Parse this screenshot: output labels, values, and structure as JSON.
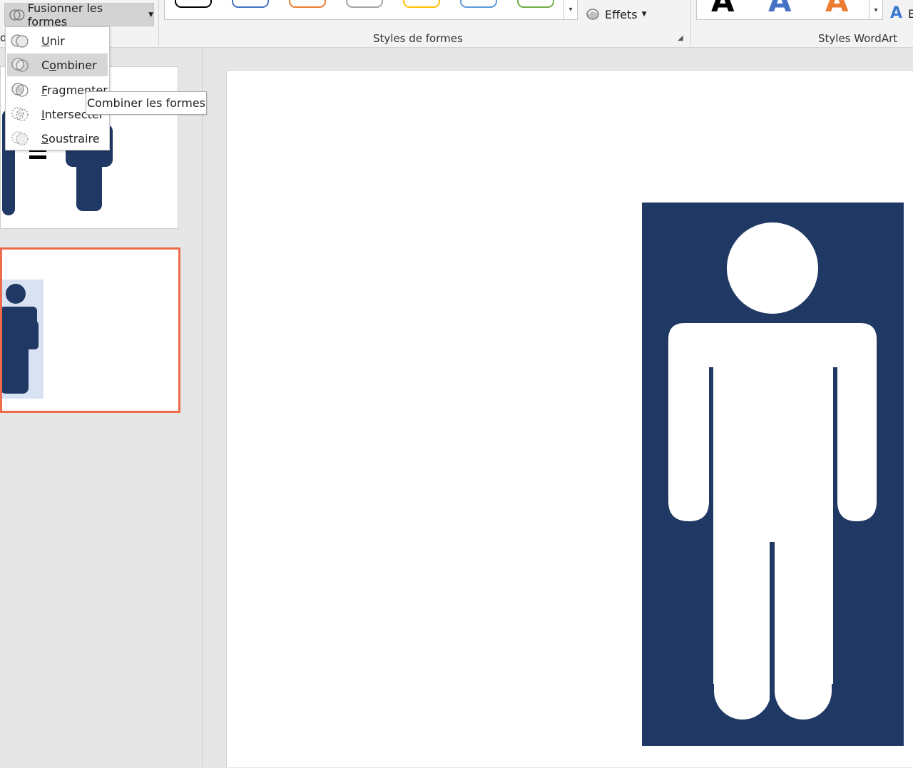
{
  "ribbon": {
    "merge_shapes_label": "Fusionner les formes",
    "edge_letter": "d",
    "effects_label": "Effets",
    "shape_styles_label": "Styles de formes",
    "wordart_styles_label": "Styles WordArt",
    "wordart_letter": "A",
    "wordart_cut_letter": "E",
    "swatch_colors": [
      "#000000",
      "#4472c4",
      "#ed7d31",
      "#a5a5a5",
      "#ffc000",
      "#5b9bd5",
      "#70ad47"
    ],
    "wordart_colors": [
      "#000000",
      "#4472c4",
      "#ed7d31"
    ]
  },
  "merge_menu": {
    "items": [
      {
        "pre": "",
        "underline": "U",
        "post": "nir"
      },
      {
        "pre": "C",
        "underline": "o",
        "post": "mbiner"
      },
      {
        "pre": "",
        "underline": "F",
        "post": "ragmenter"
      },
      {
        "pre": "",
        "underline": "I",
        "post": "ntersecter"
      },
      {
        "pre": "",
        "underline": "S",
        "post": "oustraire"
      }
    ],
    "hovered_index": 1
  },
  "tooltip": {
    "text": "Combiner les formes"
  },
  "colors": {
    "navy": "#203864",
    "selection_border": "#ee6c4d",
    "selection_fill": "#d9e2f3"
  }
}
